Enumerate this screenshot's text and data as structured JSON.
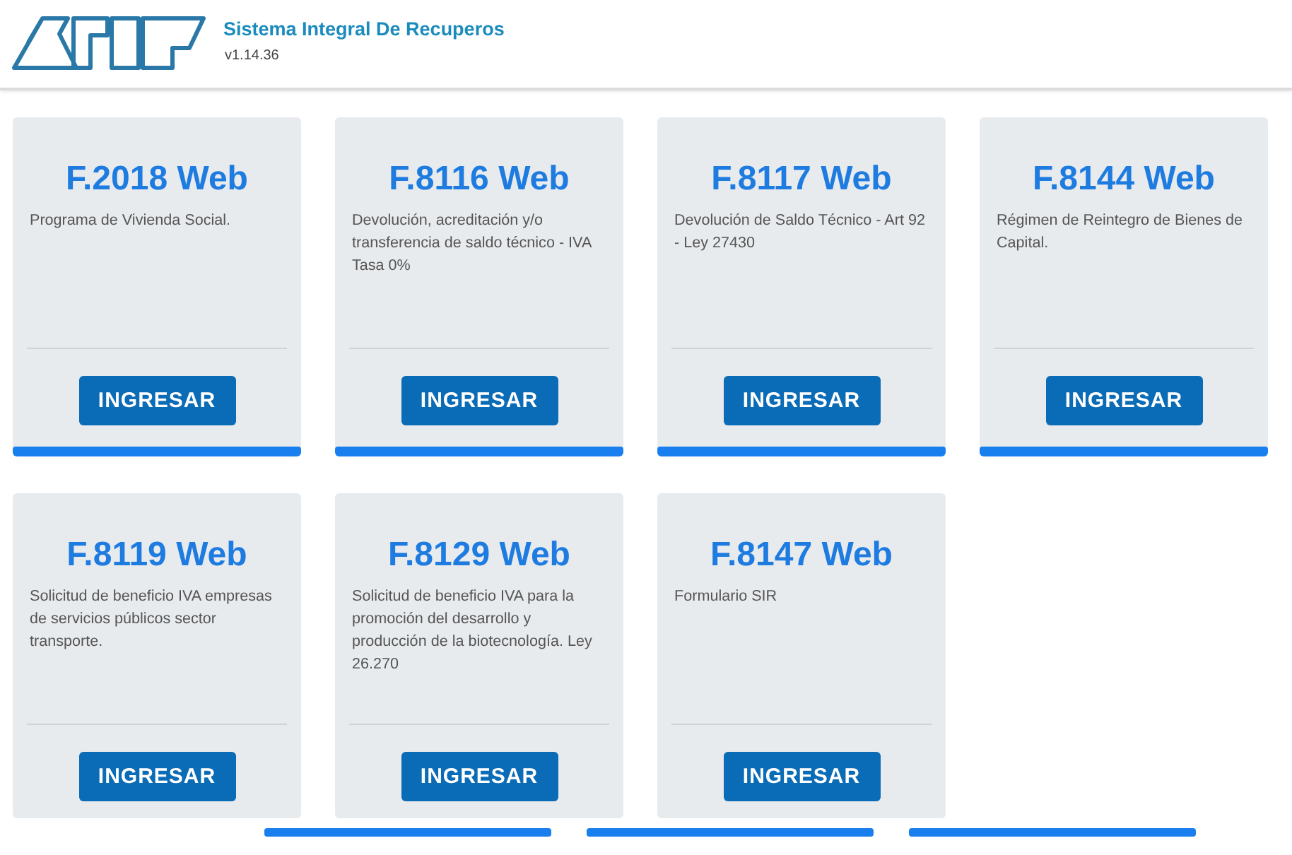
{
  "header": {
    "title": "Sistema Integral De Recuperos",
    "version": "v1.14.36"
  },
  "cards": [
    {
      "title": "F.2018 Web",
      "description": "Programa de Vivienda Social.",
      "button": "INGRESAR",
      "kind": "attached"
    },
    {
      "title": "F.8116 Web",
      "description": "Devolución, acreditación y/o transferencia de saldo técnico - IVA Tasa 0%",
      "button": "INGRESAR",
      "kind": "attached"
    },
    {
      "title": "F.8117 Web",
      "description": "Devolución de Saldo Técnico - Art 92 - Ley 27430",
      "button": "INGRESAR",
      "kind": "attached"
    },
    {
      "title": "F.8144 Web",
      "description": "Régimen de Reintegro de Bienes de Capital.",
      "button": "INGRESAR",
      "kind": "attached"
    },
    {
      "title": "F.8119 Web",
      "description": "Solicitud de beneficio IVA empresas de servicios públicos sector transporte.",
      "button": "INGRESAR",
      "kind": "detached"
    },
    {
      "title": "F.8129 Web",
      "description": "Solicitud de beneficio IVA para la promoción del desarrollo y producción de la biotecnología. Ley 26.270",
      "button": "INGRESAR",
      "kind": "detached"
    },
    {
      "title": "F.8147 Web",
      "description": "Formulario SIR",
      "button": "INGRESAR",
      "kind": "detached"
    }
  ]
}
